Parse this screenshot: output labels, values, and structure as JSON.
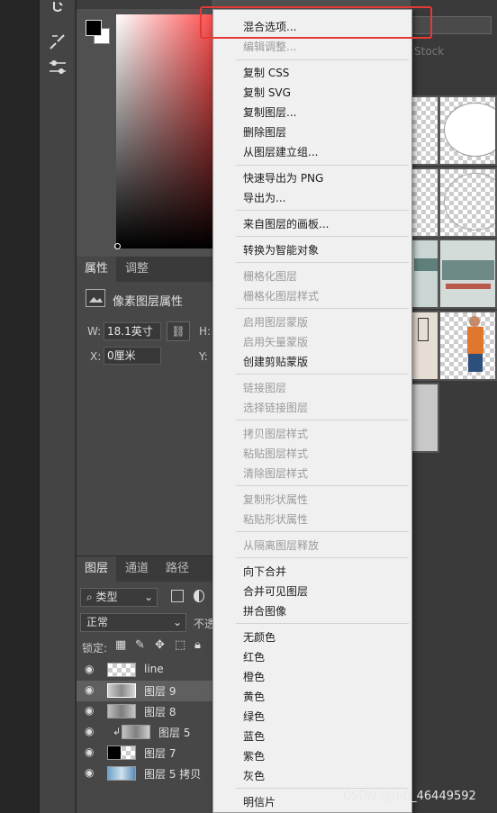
{
  "colors": {
    "menu_bg": "#f0f0f0",
    "menu_text": "#1a1a1a",
    "menu_disabled": "#9a9a9a",
    "highlight_border": "#e53935",
    "panel_bg": "#474747"
  },
  "right_panel": {
    "stock_label": "Stock"
  },
  "properties": {
    "tabs": [
      "属性",
      "调整"
    ],
    "pixel_layer_title": "像素图层属性",
    "w_label": "W:",
    "w_value": "18.1英寸",
    "h_label": "H:",
    "x_label": "X:",
    "x_value": "0厘米",
    "y_label": "Y:"
  },
  "layers": {
    "tabs": [
      "图层",
      "通道",
      "路径"
    ],
    "filter_kind": "类型",
    "blend_mode": "正常",
    "opacity_label": "不透",
    "lock_label": "锁定:",
    "items": [
      {
        "name": "line"
      },
      {
        "name": "图层 9"
      },
      {
        "name": "图层 8"
      },
      {
        "name": "图层 5"
      },
      {
        "name": "图层 7"
      },
      {
        "name": "图层 5 拷贝"
      }
    ]
  },
  "context_menu": {
    "items": [
      {
        "label": "混合选项...",
        "disabled": false
      },
      {
        "label": "编辑调整...",
        "disabled": true
      },
      {
        "label": "复制 CSS",
        "disabled": false
      },
      {
        "label": "复制 SVG",
        "disabled": false
      },
      {
        "label": "复制图层...",
        "disabled": false
      },
      {
        "label": "删除图层",
        "disabled": false
      },
      {
        "label": "从图层建立组...",
        "disabled": false
      },
      {
        "label": "快速导出为 PNG",
        "disabled": false
      },
      {
        "label": "导出为...",
        "disabled": false
      },
      {
        "label": "来自图层的画板...",
        "disabled": false
      },
      {
        "label": "转换为智能对象",
        "disabled": false
      },
      {
        "label": "栅格化图层",
        "disabled": true
      },
      {
        "label": "栅格化图层样式",
        "disabled": true
      },
      {
        "label": "启用图层蒙版",
        "disabled": true
      },
      {
        "label": "启用矢量蒙版",
        "disabled": true
      },
      {
        "label": "创建剪贴蒙版",
        "disabled": false
      },
      {
        "label": "链接图层",
        "disabled": true
      },
      {
        "label": "选择链接图层",
        "disabled": true
      },
      {
        "label": "拷贝图层样式",
        "disabled": true
      },
      {
        "label": "粘贴图层样式",
        "disabled": true
      },
      {
        "label": "清除图层样式",
        "disabled": true
      },
      {
        "label": "复制形状属性",
        "disabled": true
      },
      {
        "label": "粘贴形状属性",
        "disabled": true
      },
      {
        "label": "从隔离图层释放",
        "disabled": true
      },
      {
        "label": "向下合并",
        "disabled": false
      },
      {
        "label": "合并可见图层",
        "disabled": false
      },
      {
        "label": "拼合图像",
        "disabled": false
      },
      {
        "label": "无颜色",
        "disabled": false
      },
      {
        "label": "红色",
        "disabled": false
      },
      {
        "label": "橙色",
        "disabled": false
      },
      {
        "label": "黄色",
        "disabled": false
      },
      {
        "label": "绿色",
        "disabled": false
      },
      {
        "label": "蓝色",
        "disabled": false
      },
      {
        "label": "紫色",
        "disabled": false
      },
      {
        "label": "灰色",
        "disabled": false
      },
      {
        "label": "明信片",
        "disabled": false
      }
    ]
  },
  "watermark": "CSDN @m0_46449592"
}
